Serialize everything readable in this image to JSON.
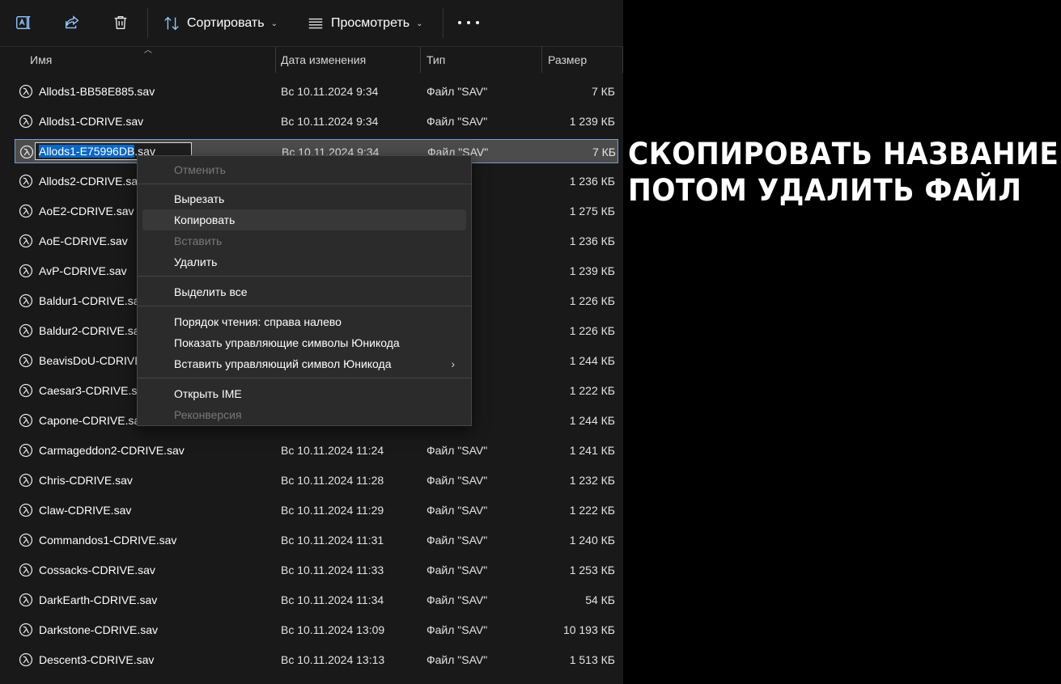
{
  "toolbar": {
    "sort_label": "Сортировать",
    "view_label": "Просмотреть"
  },
  "columns": {
    "name": "Имя",
    "date": "Дата изменения",
    "type": "Тип",
    "size": "Размер"
  },
  "files": [
    {
      "name": "Allods1-BB58E885.sav",
      "date": "Вс 10.11.2024 9:34",
      "type": "Файл \"SAV\"",
      "size": "7 КБ"
    },
    {
      "name": "Allods1-CDRIVE.sav",
      "date": "Вс 10.11.2024 9:34",
      "type": "Файл \"SAV\"",
      "size": "1 239 КБ"
    },
    {
      "name": "Allods1-E75996DB.sav",
      "date": "Вс 10.11.2024 9:34",
      "type": "Файл \"SAV\"",
      "size": "7 КБ"
    },
    {
      "name": "Allods2-CDRIVE.sav",
      "date": "",
      "type": "",
      "size": "1 236 КБ"
    },
    {
      "name": "AoE2-CDRIVE.sav",
      "date": "",
      "type": "",
      "size": "1 275 КБ"
    },
    {
      "name": "AoE-CDRIVE.sav",
      "date": "",
      "type": "",
      "size": "1 236 КБ"
    },
    {
      "name": "AvP-CDRIVE.sav",
      "date": "",
      "type": "",
      "size": "1 239 КБ"
    },
    {
      "name": "Baldur1-CDRIVE.sav",
      "date": "",
      "type": "",
      "size": "1 226 КБ"
    },
    {
      "name": "Baldur2-CDRIVE.sav",
      "date": "",
      "type": "",
      "size": "1 226 КБ"
    },
    {
      "name": "BeavisDoU-CDRIVE.sav",
      "date": "",
      "type": "",
      "size": "1 244 КБ"
    },
    {
      "name": "Caesar3-CDRIVE.sav",
      "date": "",
      "type": "",
      "size": "1 222 КБ"
    },
    {
      "name": "Capone-CDRIVE.sav",
      "date": "",
      "type": "",
      "size": "1 244 КБ"
    },
    {
      "name": "Carmageddon2-CDRIVE.sav",
      "date": "Вс 10.11.2024 11:24",
      "type": "Файл \"SAV\"",
      "size": "1 241 КБ"
    },
    {
      "name": "Chris-CDRIVE.sav",
      "date": "Вс 10.11.2024 11:28",
      "type": "Файл \"SAV\"",
      "size": "1 232 КБ"
    },
    {
      "name": "Claw-CDRIVE.sav",
      "date": "Вс 10.11.2024 11:29",
      "type": "Файл \"SAV\"",
      "size": "1 222 КБ"
    },
    {
      "name": "Commandos1-CDRIVE.sav",
      "date": "Вс 10.11.2024 11:31",
      "type": "Файл \"SAV\"",
      "size": "1 240 КБ"
    },
    {
      "name": "Cossacks-CDRIVE.sav",
      "date": "Вс 10.11.2024 11:33",
      "type": "Файл \"SAV\"",
      "size": "1 253 КБ"
    },
    {
      "name": "DarkEarth-CDRIVE.sav",
      "date": "Вс 10.11.2024 11:34",
      "type": "Файл \"SAV\"",
      "size": "54 КБ"
    },
    {
      "name": "Darkstone-CDRIVE.sav",
      "date": "Вс 10.11.2024 13:09",
      "type": "Файл \"SAV\"",
      "size": "10 193 КБ"
    },
    {
      "name": "Descent3-CDRIVE.sav",
      "date": "Вс 10.11.2024 13:13",
      "type": "Файл \"SAV\"",
      "size": "1 513 КБ"
    }
  ],
  "rename": {
    "selected_text": "Allods1-E75996DB",
    "rest_text": ".sav"
  },
  "context_menu": {
    "undo": "Отменить",
    "cut": "Вырезать",
    "copy": "Копировать",
    "paste": "Вставить",
    "delete": "Удалить",
    "select_all": "Выделить все",
    "rtl": "Порядок чтения: справа налево",
    "show_unicode": "Показать управляющие символы Юникода",
    "insert_unicode": "Вставить управляющий символ Юникода",
    "open_ime": "Открыть IME",
    "reconversion": "Реконверсия"
  },
  "annotation": {
    "line1": "СКОПИРОВАТЬ НАЗВАНИЕ",
    "line2": "ПОТОМ УДАЛИТЬ ФАЙЛ"
  },
  "colors": {
    "background": "#191919",
    "selection_border": "#7c9ec7",
    "text_highlight": "#0a67c5",
    "menu_bg": "#2b2b2b"
  }
}
